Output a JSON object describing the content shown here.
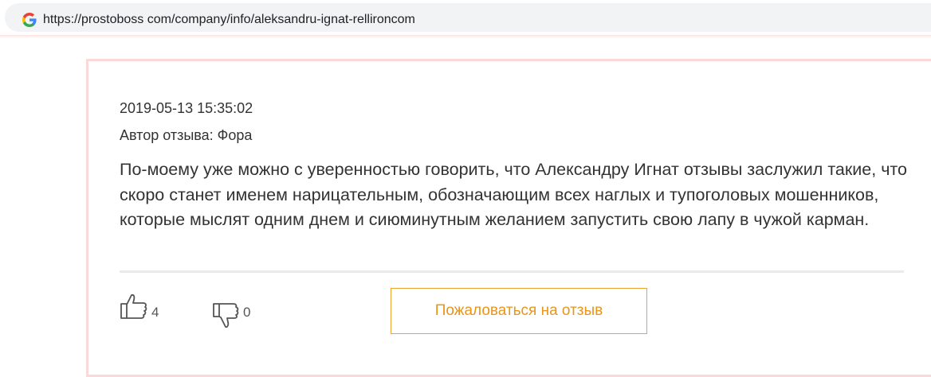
{
  "browser": {
    "url": "https://prostoboss com/company/info/aleksandru-ignat-rellironcom",
    "search_engine_icon": "google-g-icon"
  },
  "review": {
    "date": "2019-05-13 15:35:02",
    "author": "Автор отзыва: Фора",
    "text": "По-моему уже можно с уверенностью говорить, что Александру Игнат отзывы заслужил такие, что скоро станет именем нарицательным, обозначающим всех наглых и тупоголовых мошенников, которые мыслят одним днем и сиюминутным желанием запустить свою лапу в чужой карман."
  },
  "actions": {
    "likes": "4",
    "dislikes": "0",
    "like_icon": "thumbs-up-icon",
    "dislike_icon": "thumbs-down-icon",
    "report_label": "Пожаловаться на отзыв"
  },
  "colors": {
    "card_border": "#fbd9d9",
    "accent": "#e8951a",
    "text": "#333333"
  }
}
